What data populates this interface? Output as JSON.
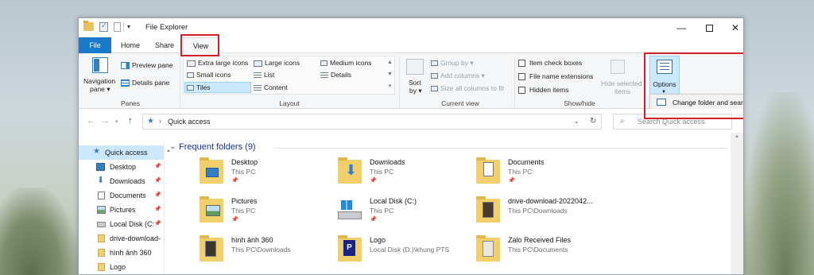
{
  "window": {
    "title": "File Explorer"
  },
  "tabs": {
    "file": "File",
    "home": "Home",
    "share": "Share",
    "view": "View"
  },
  "ribbon": {
    "panes": {
      "navigation_pane": "Navigation",
      "navigation_pane_2": "pane",
      "preview_pane": "Preview pane",
      "details_pane": "Details pane",
      "label": "Panes"
    },
    "layout": {
      "extra_large_icons": "Extra large icons",
      "large_icons": "Large icons",
      "medium_icons": "Medium icons",
      "small_icons": "Small icons",
      "list": "List",
      "details": "Details",
      "tiles": "Tiles",
      "content": "Content",
      "label": "Layout"
    },
    "current_view": {
      "sort_by": "Sort",
      "sort_by_2": "by",
      "group_by": "Group by",
      "add_columns": "Add columns",
      "size_all_columns": "Size all columns to fit",
      "label": "Current view"
    },
    "show_hide": {
      "item_check_boxes": "Item check boxes",
      "file_name_extensions": "File name extensions",
      "hidden_items": "Hidden items",
      "hide_selected": "Hide selected",
      "hide_selected_2": "items",
      "label": "Show/hide"
    },
    "options": {
      "label": "Options",
      "menu_item": "Change folder and search options"
    }
  },
  "address": {
    "location": "Quick access",
    "search_placeholder": "Search Quick access"
  },
  "nav_pane": {
    "items": [
      {
        "label": "Quick access",
        "icon": "star-icon",
        "pinned": false
      },
      {
        "label": "Desktop",
        "icon": "desktop-icon",
        "pinned": true
      },
      {
        "label": "Downloads",
        "icon": "download-icon",
        "pinned": true
      },
      {
        "label": "Documents",
        "icon": "document-icon",
        "pinned": true
      },
      {
        "label": "Pictures",
        "icon": "pictures-icon",
        "pinned": true
      },
      {
        "label": "Local Disk (C:",
        "icon": "disk-icon",
        "pinned": true
      },
      {
        "label": "drive-download-",
        "icon": "folder-icon",
        "pinned": false
      },
      {
        "label": "hình ảnh 360",
        "icon": "folder-icon",
        "pinned": false
      },
      {
        "label": "Logo",
        "icon": "folder-icon",
        "pinned": false
      }
    ]
  },
  "content": {
    "section_title": "Frequent folders (9)",
    "folders": [
      {
        "name": "Desktop",
        "location": "This PC",
        "pinned": true
      },
      {
        "name": "Downloads",
        "location": "This PC",
        "pinned": true
      },
      {
        "name": "Documents",
        "location": "This PC",
        "pinned": true
      },
      {
        "name": "Pictures",
        "location": "This PC",
        "pinned": true
      },
      {
        "name": "Local Disk (C:)",
        "location": "This PC",
        "pinned": true
      },
      {
        "name": "drive-download-2022042...",
        "location": "This PC\\Downloads",
        "pinned": false
      },
      {
        "name": "hình ảnh 360",
        "location": "This PC\\Downloads",
        "pinned": false
      },
      {
        "name": "Logo",
        "location": "Local Disk (D:)\\khung PTS",
        "pinned": false
      },
      {
        "name": "Zalo Received Files",
        "location": "This PC\\Documents",
        "pinned": false
      }
    ]
  },
  "colors": {
    "accent": "#1979ca",
    "highlight_box": "#d0202a",
    "selection": "#cce8ff"
  }
}
